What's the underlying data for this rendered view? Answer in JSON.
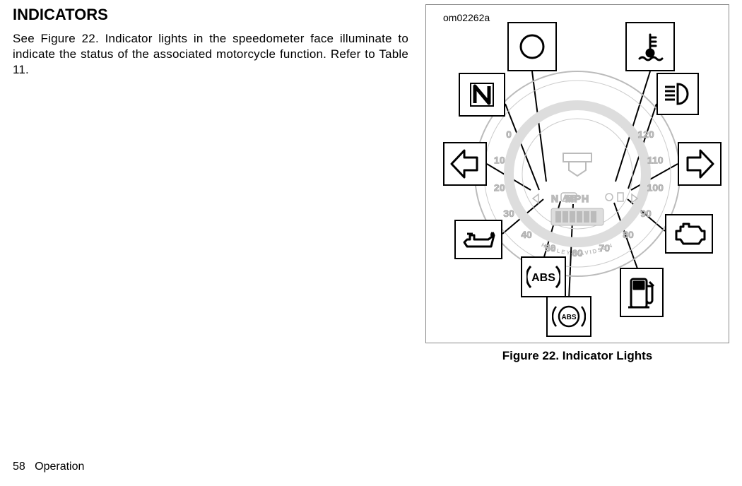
{
  "heading": "INDICATORS",
  "body": "See Figure 22. Indicator lights in the speedometer face illuminate to indicate the status of the associated motorcycle function. Refer to Table 11.",
  "figure": {
    "label": "om02262a",
    "caption": "Figure 22. Indicator Lights",
    "gauge": {
      "unit": "MPH",
      "brand": "HARLEY-DAVIDSON",
      "ticks": [
        "0",
        "10",
        "20",
        "30",
        "40",
        "50",
        "60",
        "70",
        "80",
        "90",
        "100",
        "110",
        "120"
      ]
    },
    "callouts": {
      "security": "security-icon",
      "coolant": "coolant-temp-icon",
      "neutral": "neutral-icon",
      "highbeam": "high-beam-icon",
      "turn_l": "left-turn-icon",
      "turn_r": "right-turn-icon",
      "oil": "oil-pressure-icon",
      "engine": "check-engine-icon",
      "abs": "abs-icon",
      "abs2": "abs-icon-alt",
      "fuel": "low-fuel-icon"
    }
  },
  "footer": {
    "page": "58",
    "section": "Operation"
  }
}
